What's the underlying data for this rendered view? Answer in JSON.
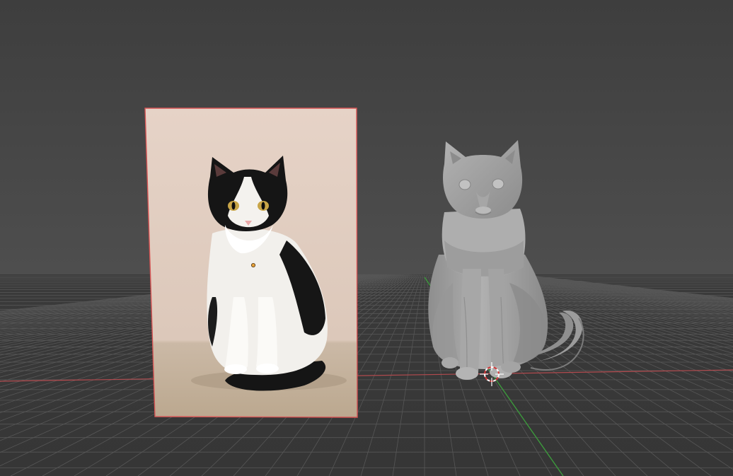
{
  "viewport": {
    "mode": "3d-viewport",
    "background_top_color": "#3e3e3e",
    "background_horizon_color": "#5a5a5a",
    "floor_color": "#3a3a3a",
    "grid_color": "#575757",
    "x_axis_color": "#b24a4e",
    "y_axis_color": "#3c9a3c",
    "selection_outline_color": "#d65555",
    "origin_dot_color": "#e8a23a",
    "cursor_icon": "3d-cursor-icon"
  },
  "objects": {
    "reference_image": {
      "icon": "image-plane-icon",
      "subject": "black-and-white-cat-photo",
      "selected": true,
      "backdrop_color": "#e6d3c7"
    },
    "cat_model": {
      "icon": "mesh-object-icon",
      "subject": "sitting-cat-mesh",
      "material_color": "#a4a4a4",
      "selected": false
    }
  }
}
